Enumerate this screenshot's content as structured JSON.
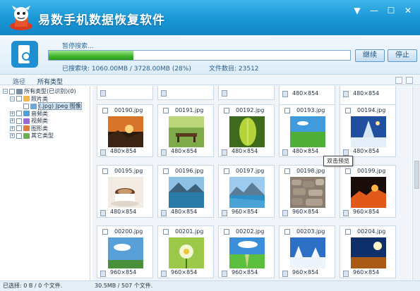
{
  "app": {
    "title": "易数手机数据恢复软件"
  },
  "status": {
    "state_label": "暂停搜索...",
    "progress_percent": 28,
    "scan_info": "已搜索块: 1060.00MB / 3728.00MB (28%)",
    "file_count": "文件数目:    23512",
    "continue_label": "继续",
    "stop_label": "停止"
  },
  "tabs": [
    {
      "label": "路径"
    },
    {
      "label": "所有类型"
    }
  ],
  "tree": [
    {
      "label": "所有类型(已识别)(0)",
      "expander": "−",
      "level": 0
    },
    {
      "label": "照片类",
      "expander": "−",
      "level": 1
    },
    {
      "label": "(.jpg) Jpeg 图像",
      "expander": "",
      "level": 2
    },
    {
      "label": "音频类",
      "expander": "+",
      "level": 1
    },
    {
      "label": "视频类",
      "expander": "+",
      "level": 1
    },
    {
      "label": "图形类",
      "expander": "+",
      "level": 1
    },
    {
      "label": "其它类型",
      "expander": "+",
      "level": 1
    }
  ],
  "top_partial_row": [
    "480×854",
    "480×854"
  ],
  "files": [
    {
      "name": "00190.jpg",
      "dim": "480×854",
      "scene": "sunset"
    },
    {
      "name": "00191.jpg",
      "dim": "480×854",
      "scene": "bench"
    },
    {
      "name": "00192.jpg",
      "dim": "480×854",
      "scene": "leaf"
    },
    {
      "name": "00193.jpg",
      "dim": "480×854",
      "scene": "field"
    },
    {
      "name": "00194.jpg",
      "dim": "480×854",
      "scene": "snowtree"
    },
    {
      "name": "00195.jpg",
      "dim": "480×854",
      "scene": "coffee"
    },
    {
      "name": "00196.jpg",
      "dim": "480×854",
      "scene": "lake"
    },
    {
      "name": "00197.jpg",
      "dim": "960×854",
      "scene": "mountains"
    },
    {
      "name": "00198.jpg",
      "dim": "960×854",
      "scene": "stone"
    },
    {
      "name": "00199.jpg",
      "dim": "960×854",
      "scene": "lava"
    },
    {
      "name": "00200.jpg",
      "dim": "960×854",
      "scene": "sky"
    },
    {
      "name": "00201.jpg",
      "dim": "960×854",
      "scene": "flower"
    },
    {
      "name": "00202.jpg",
      "dim": "960×854",
      "scene": "meadow"
    },
    {
      "name": "00203.jpg",
      "dim": "960×854",
      "scene": "winter"
    },
    {
      "name": "00204.jpg",
      "dim": "960×854",
      "scene": "sunflare"
    }
  ],
  "tooltip": "双击预览",
  "footer": {
    "selected": "已选择: 0 B / 0 个文件.",
    "total": "30.5MB / 507 个文件."
  },
  "colors": {
    "accent": "#1896d5",
    "progress": "#3fb529"
  }
}
